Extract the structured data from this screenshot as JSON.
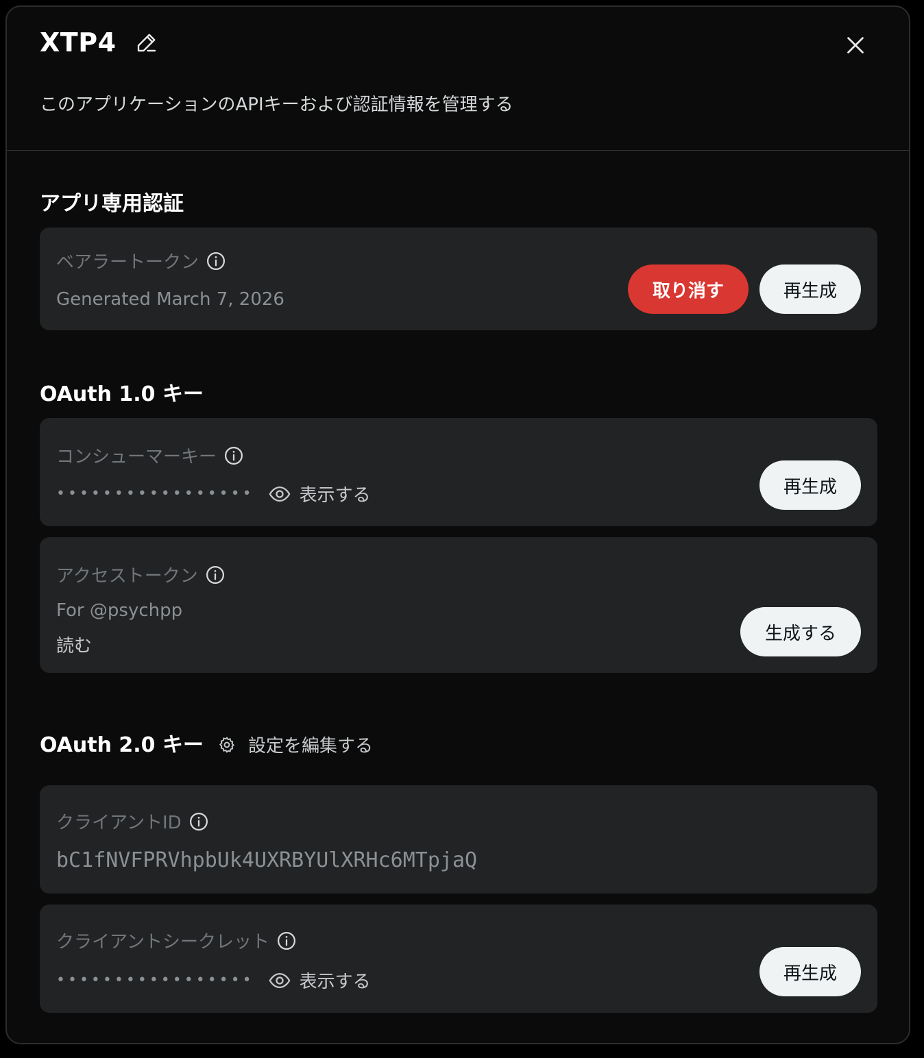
{
  "header": {
    "title": "XTP4",
    "subtitle": "このアプリケーションのAPIキーおよび認証情報を管理する"
  },
  "app_only_auth": {
    "section_title": "アプリ専用認証",
    "bearer": {
      "label": "ベアラートークン",
      "generated": "Generated March 7, 2026",
      "revoke_label": "取り消す",
      "regenerate_label": "再生成"
    }
  },
  "oauth1": {
    "section_title": "OAuth 1.0 キー",
    "consumer": {
      "label": "コンシューマーキー",
      "masked": "•••••••••••••••••",
      "show_label": "表示する",
      "regenerate_label": "再生成"
    },
    "access": {
      "label": "アクセストークン",
      "for_user": "For @psychpp",
      "permission": "読む",
      "generate_label": "生成する"
    }
  },
  "oauth2": {
    "section_title": "OAuth 2.0 キー",
    "edit_settings_label": "設定を編集する",
    "client_id": {
      "label": "クライアントID",
      "value": "bC1fNVFPRVhpbUk4UXRBYUlXRHc6MTpjaQ"
    },
    "client_secret": {
      "label": "クライアントシークレット",
      "masked": "•••••••••••••••••",
      "show_label": "表示する",
      "regenerate_label": "再生成"
    }
  },
  "colors": {
    "danger": "#d93731",
    "card": "#222324",
    "panel": "#0b0b0b"
  }
}
